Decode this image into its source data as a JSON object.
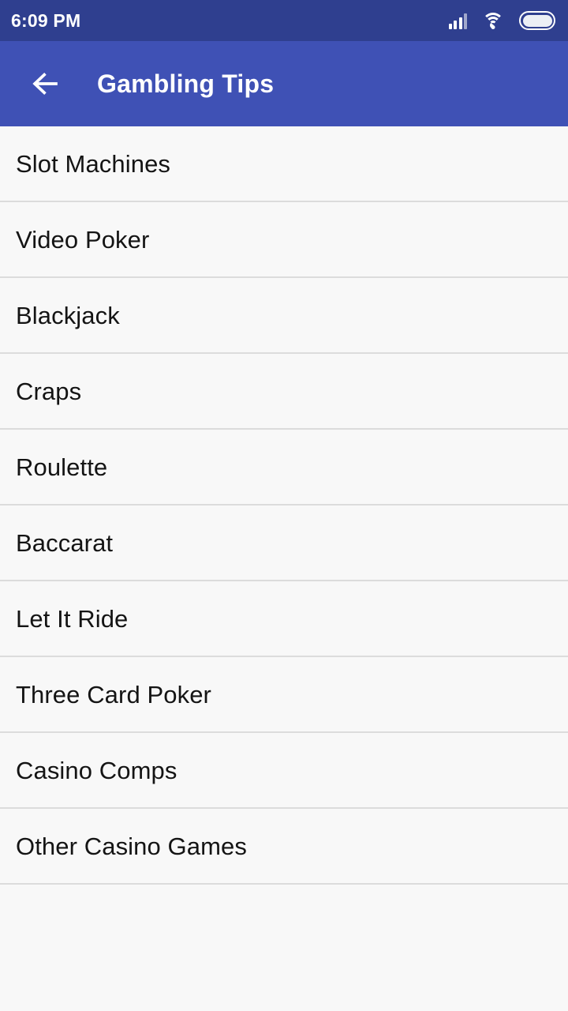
{
  "status_bar": {
    "time": "6:09 PM",
    "background_color": "#2f3f8f",
    "icons": [
      {
        "name": "signal-icon",
        "label": "Cellular signal"
      },
      {
        "name": "wifi-icon",
        "label": "Wi-Fi connected"
      },
      {
        "name": "battery-icon",
        "label": "Battery full"
      }
    ]
  },
  "app_bar": {
    "title": "Gambling Tips",
    "back_icon": "arrow-left-icon",
    "background_color": "#3f51b5",
    "text_color": "#ffffff"
  },
  "list": {
    "divider_color": "#dcdcdc",
    "background_color": "#f8f8f8",
    "text_color": "#141414",
    "items": [
      {
        "label": "Slot Machines"
      },
      {
        "label": "Video Poker"
      },
      {
        "label": "Blackjack"
      },
      {
        "label": "Craps"
      },
      {
        "label": "Roulette"
      },
      {
        "label": "Baccarat"
      },
      {
        "label": "Let It Ride"
      },
      {
        "label": "Three Card Poker"
      },
      {
        "label": "Casino Comps"
      },
      {
        "label": "Other Casino Games"
      }
    ]
  }
}
